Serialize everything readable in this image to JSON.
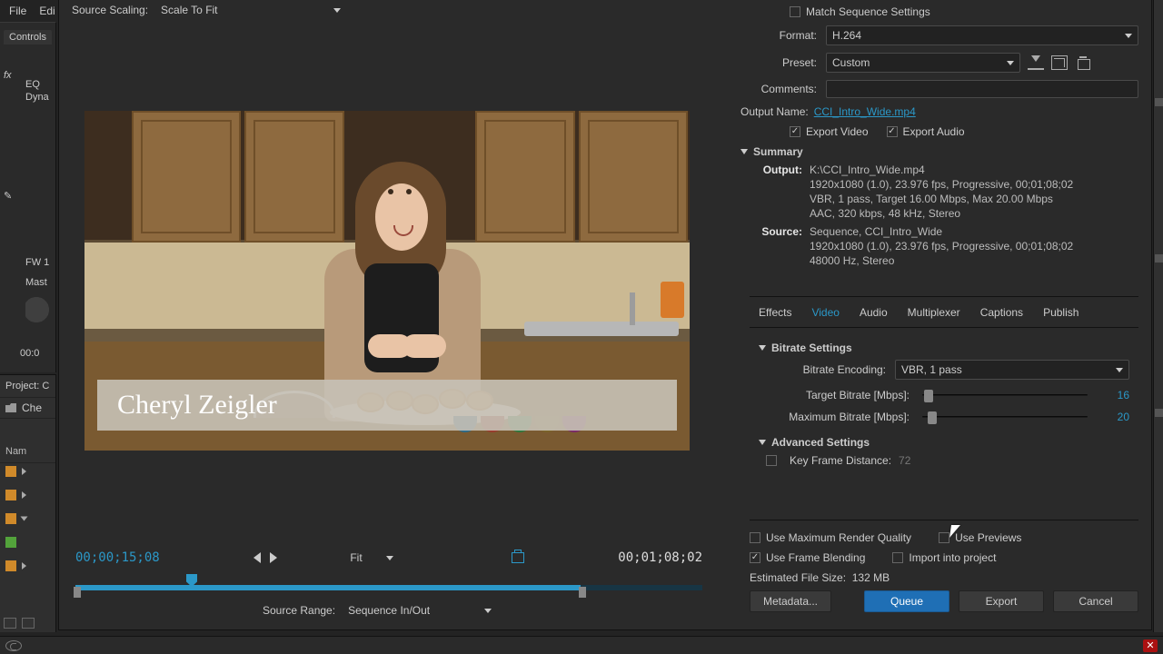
{
  "menu": {
    "file": "File",
    "edit": "Edi"
  },
  "farleft": {
    "controls_tab": "Controls",
    "fx_label": "fx",
    "eq": "EQ",
    "dyna": "Dyna",
    "fw": "FW 1",
    "mast": "Mast",
    "tc": "00:0"
  },
  "project": {
    "header": "Project: C",
    "search_placeholder": "Che",
    "col_name": "Nam"
  },
  "source_scaling": {
    "label": "Source Scaling:",
    "value": "Scale To Fit"
  },
  "preview": {
    "lower_third_name": "Cheryl Zeigler"
  },
  "timeline": {
    "current": "00;00;15;08",
    "duration": "00;01;08;02",
    "fit_label": "Fit"
  },
  "source_range": {
    "label": "Source Range:",
    "value": "Sequence In/Out"
  },
  "export": {
    "match_seq": "Match Sequence Settings",
    "format_label": "Format:",
    "format_value": "H.264",
    "preset_label": "Preset:",
    "preset_value": "Custom",
    "comments_label": "Comments:",
    "output_name_label": "Output Name:",
    "output_name_value": "CCI_Intro_Wide.mp4",
    "export_video": "Export Video",
    "export_audio": "Export Audio",
    "summary_title": "Summary",
    "summary": {
      "output_key": "Output:",
      "output_l1": "K:\\CCI_Intro_Wide.mp4",
      "output_l2": "1920x1080 (1.0), 23.976 fps, Progressive, 00;01;08;02",
      "output_l3": "VBR, 1 pass, Target 16.00 Mbps, Max 20.00 Mbps",
      "output_l4": "AAC, 320 kbps, 48 kHz, Stereo",
      "source_key": "Source:",
      "source_l1": "Sequence, CCI_Intro_Wide",
      "source_l2": "1920x1080 (1.0), 23.976 fps, Progressive, 00;01;08;02",
      "source_l3": "48000 Hz, Stereo"
    }
  },
  "tabs": {
    "effects": "Effects",
    "video": "Video",
    "audio": "Audio",
    "multiplexer": "Multiplexer",
    "captions": "Captions",
    "publish": "Publish"
  },
  "bitrate": {
    "section": "Bitrate Settings",
    "encoding_label": "Bitrate Encoding:",
    "encoding_value": "VBR, 1 pass",
    "target_label": "Target Bitrate [Mbps]:",
    "target_value": "16",
    "max_label": "Maximum Bitrate [Mbps]:",
    "max_value": "20"
  },
  "advanced": {
    "section": "Advanced Settings",
    "kf_label": "Key Frame Distance:",
    "kf_value": "72"
  },
  "bottom": {
    "max_render": "Use Maximum Render Quality",
    "previews": "Use Previews",
    "frame_blend": "Use Frame Blending",
    "import": "Import into project",
    "est_label": "Estimated File Size:",
    "est_value": "132 MB"
  },
  "buttons": {
    "metadata": "Metadata...",
    "queue": "Queue",
    "export": "Export",
    "cancel": "Cancel"
  }
}
